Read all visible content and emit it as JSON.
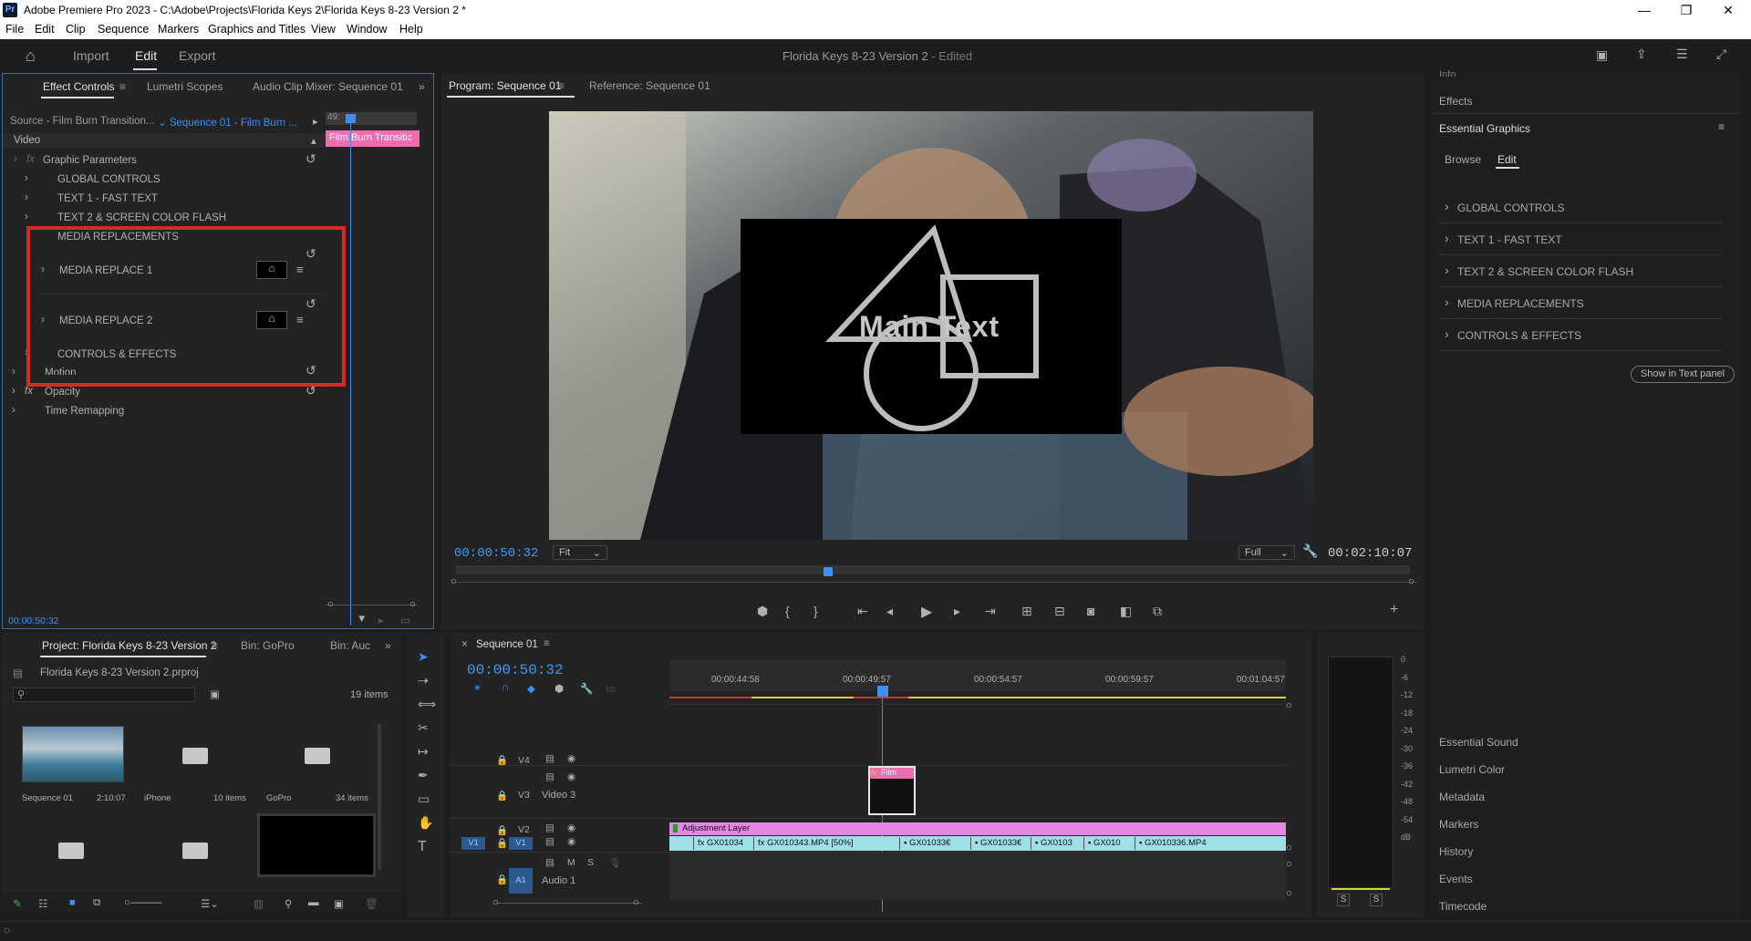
{
  "window": {
    "title": "Adobe Premiere Pro 2023 - C:\\Adobe\\Projects\\Florida Keys 2\\Florida Keys 8-23 Version 2 *",
    "app_badge": "Pr"
  },
  "menu": [
    "File",
    "Edit",
    "Clip",
    "Sequence",
    "Markers",
    "Graphics and Titles",
    "View",
    "Window",
    "Help"
  ],
  "header": {
    "nav": [
      "Import",
      "Edit",
      "Export"
    ],
    "project_title": "Florida Keys 8-23 Version 2",
    "status": "- Edited"
  },
  "effect_controls": {
    "tabs": [
      "Effect Controls",
      "Lumetri Scopes",
      "Audio Clip Mixer: Sequence 01"
    ],
    "source": "Source - Film Burn Transition...",
    "sequence": "Sequence 01 - Film Burn ...",
    "timeline_tc": "49:",
    "clip_label": "Film Burn Transitic",
    "section": "Video",
    "items": [
      "Graphic Parameters",
      "GLOBAL CONTROLS",
      "TEXT 1 - FAST TEXT",
      "TEXT 2 & SCREEN COLOR FLASH",
      "MEDIA REPLACEMENTS",
      "MEDIA REPLACE 1",
      "MEDIA REPLACE 2",
      "CONTROLS & EFFECTS",
      "Motion",
      "Opacity",
      "Time Remapping"
    ],
    "fx": "fx",
    "timecode": "00:00:50:32",
    "highlight_color": "#d42a2a"
  },
  "program": {
    "tabs": [
      "Program: Sequence 01",
      "Reference: Sequence 01"
    ],
    "overlay_text": "Main Text",
    "timecode": "00:00:50:32",
    "fit": "Fit",
    "quality": "Full",
    "duration": "00:02:10:07",
    "playhead_fraction": 0.39
  },
  "essential_graphics": {
    "info": "Info",
    "effects": "Effects",
    "title": "Essential Graphics",
    "tabs": [
      "Browse",
      "Edit"
    ],
    "items": [
      "GLOBAL CONTROLS",
      "TEXT 1 - FAST TEXT",
      "TEXT 2  & SCREEN COLOR FLASH",
      "MEDIA REPLACEMENTS",
      "CONTROLS & EFFECTS"
    ],
    "button": "Show in Text panel",
    "panels": [
      "Essential Sound",
      "Lumetri Color",
      "Metadata",
      "Markers",
      "History",
      "Events",
      "Timecode"
    ]
  },
  "project": {
    "tabs": [
      "Project: Florida Keys 8-23 Version 2",
      "Bin: GoPro",
      "Bin: Auc"
    ],
    "file": "Florida Keys 8-23 Version 2.prproj",
    "count": "19 items",
    "bins": [
      {
        "name": "Sequence 01",
        "meta": "2:10:07"
      },
      {
        "name": "iPhone",
        "meta": "10 items"
      },
      {
        "name": "GoPro",
        "meta": "34 items"
      }
    ]
  },
  "timeline": {
    "tab": "Sequence 01",
    "timecode": "00:00:50:32",
    "ruler": [
      "00:00:44:58",
      "00:00:49:57",
      "00:00:54:57",
      "00:00:59:57",
      "00:01:04:57"
    ],
    "tracks": {
      "v4": "V4",
      "v3": "V3",
      "v3name": "Video 3",
      "v2": "V2",
      "v1": "V1",
      "a1": "A1",
      "a1name": "Audio 1",
      "src": "V1",
      "m": "M",
      "s": "S"
    },
    "adjustment": "Adjustment Layer",
    "film_clip": "Film",
    "clips": [
      "GX01034",
      "GX010343.MP4 [50%]",
      "GX01033€",
      "GX01033€",
      "GX0103",
      "GX010",
      "GX010336.MP4"
    ],
    "fx": "fx"
  },
  "meter": {
    "scale": [
      "0",
      "-6",
      "-12",
      "-18",
      "-24",
      "-30",
      "-36",
      "-42",
      "-48",
      "-54",
      "dB"
    ],
    "solo": [
      "S",
      "S"
    ]
  }
}
